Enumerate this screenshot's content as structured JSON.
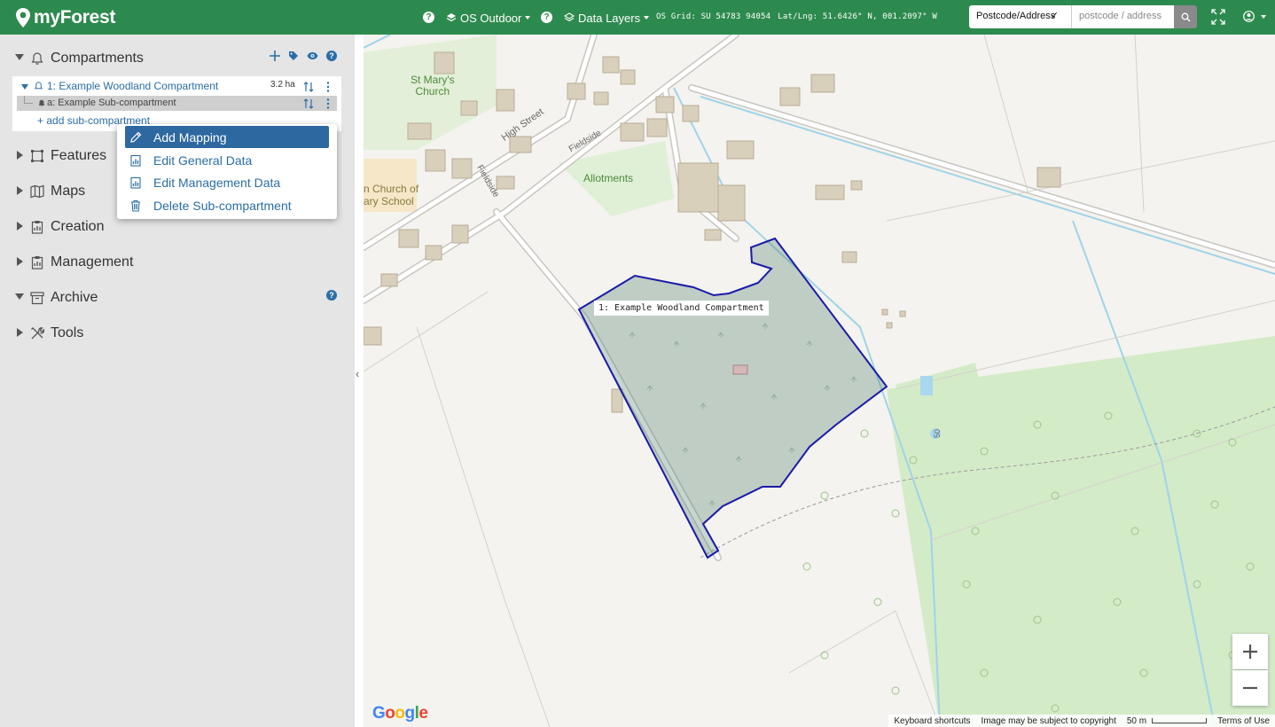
{
  "app": {
    "name": "myForest"
  },
  "topbar": {
    "basemap_label": "OS Outdoor",
    "data_layers_label": "Data Layers",
    "os_grid": "OS Grid: SU 54783 94054",
    "latlng": "Lat/Lng: 51.6426° N, 001.2097° W",
    "search_type": "Postcode/Address",
    "search_placeholder": "postcode / address",
    "accent_color": "#2d8a4e"
  },
  "sidebar": {
    "compartments": {
      "label": "Compartments",
      "items": [
        {
          "label": "1: Example Woodland Compartment",
          "area": "3.2 ha",
          "children": [
            {
              "label": "a: Example Sub-compartment"
            }
          ]
        }
      ],
      "add_sub_label": "+ add sub-compartment"
    },
    "sections": [
      {
        "label": "Features"
      },
      {
        "label": "Maps"
      },
      {
        "label": "Creation"
      },
      {
        "label": "Management"
      },
      {
        "label": "Archive"
      },
      {
        "label": "Tools"
      }
    ]
  },
  "context_menu": {
    "items": [
      {
        "label": "Add Mapping",
        "icon": "pencil-icon",
        "active": true
      },
      {
        "label": "Edit General Data",
        "icon": "chart-doc-icon"
      },
      {
        "label": "Edit Management Data",
        "icon": "chart-doc-icon"
      },
      {
        "label": "Delete Sub-compartment",
        "icon": "trash-icon"
      }
    ]
  },
  "map": {
    "labels": {
      "church": "St Mary's\nChurch",
      "high_street": "High Street",
      "fieldside": "Fieldside",
      "allotments": "Allotments",
      "school": "n Church of\nary School",
      "contour": "50"
    },
    "polygon_label": "1: Example Woodland Compartment",
    "zoom_in": "+",
    "zoom_out": "−",
    "attribution": {
      "keyboard": "Keyboard shortcuts",
      "copyright": "Image may be subject to copyright",
      "scale": "50 m",
      "terms": "Terms of Use"
    },
    "brand": "Google"
  }
}
